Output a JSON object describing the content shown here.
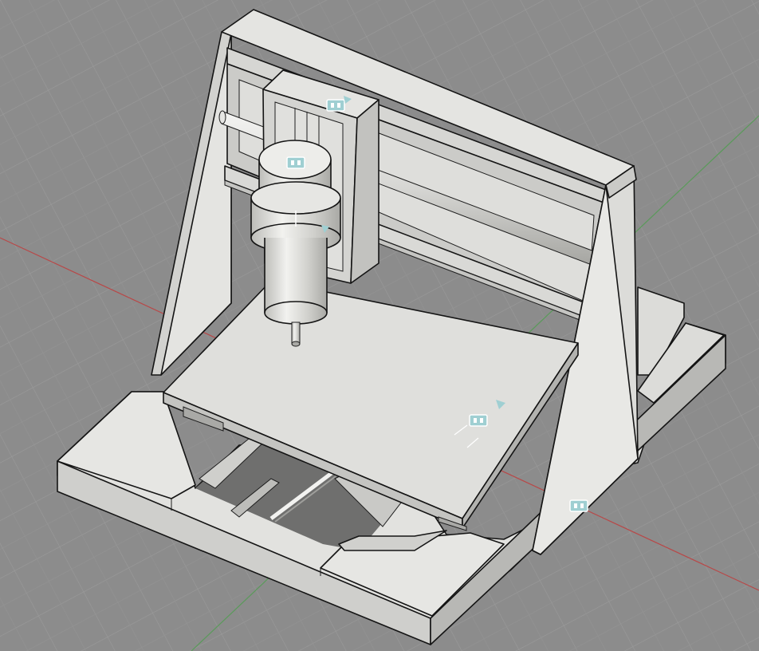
{
  "viewport": {
    "background_color": "#8c8c8c",
    "grid_color": "#9a9a9a",
    "x_axis_color": "#b84848",
    "y_axis_color": "#5a9a5a"
  },
  "model": {
    "name": "",
    "parts": [
      "base-plate",
      "worktable",
      "left-side-plate",
      "right-side-plate",
      "top-beam",
      "guide-rail-upper",
      "guide-rail-lower",
      "z-axis-carriage",
      "spindle-motor",
      "spindle-clamp",
      "end-mill"
    ],
    "body_color": "#d8d8d5",
    "edge_color": "#141414"
  },
  "joint_markers": [
    {
      "icon": "joint-icon",
      "color": "#9fcfd2"
    },
    {
      "icon": "joint-icon",
      "color": "#9fcfd2"
    },
    {
      "icon": "joint-icon",
      "color": "#9fcfd2"
    },
    {
      "icon": "joint-icon",
      "color": "#9fcfd2"
    }
  ]
}
